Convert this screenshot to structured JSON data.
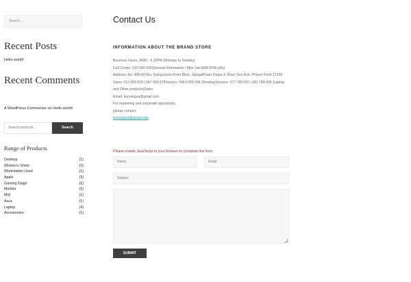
{
  "sidebar": {
    "search_placeholder": "Search ...",
    "recent_posts_title": "Recent Posts",
    "recent_posts_item": "Hello world!",
    "recent_comments_title": "Recent Comments",
    "recent_comments_item": "A WordPress Commenter on Hello world!",
    "product_search_placeholder": "Search products…",
    "product_search_button": "Search",
    "range_title": "Range of Products",
    "range_items": [
      {
        "label": "Desktop",
        "count": "(1)"
      },
      {
        "label": "Women's Shirts",
        "count": "(2)"
      },
      {
        "label": "Workstation Used",
        "count": "(1)"
      },
      {
        "label": "Apple",
        "count": "(3)"
      },
      {
        "label": "Gaming Dsign",
        "count": "(1)"
      },
      {
        "label": "Monitor",
        "count": "(1)"
      },
      {
        "label": "MSI",
        "count": "(1)"
      },
      {
        "label": "Asus",
        "count": "(1)"
      },
      {
        "label": "Laptop",
        "count": "(4)"
      },
      {
        "label": "Accessories",
        "count": "(1)"
      }
    ]
  },
  "main": {
    "title": "Contact Us",
    "info_heading": "INFORMATION ABOUT THE BRAND STORE",
    "info_lines": {
      "hours": "Business Hours: 8AM – 5.30PM (Monday to Sunday)",
      "call_center": "Call Center: 010 909 500(General Information / Mon-Sat 8AM-5PM only)",
      "address": "Address: No. 405-407Eo, Kampuchea Krom Blvd., SangatPsaer Depor 3, Khan Toul Kok, Phnom Penh 12155",
      "sales": "Sales: 012 909 878 | 087 909 878Service: 098 6789 008 (Desktop)Service: 077 789 002 | 081 789 008 (Laptop and Other products)Sales",
      "email": "Email: bunningva@gmail.com",
      "marketing": "For marketing and corporate opportunity,",
      "please_contact": "please contact:",
      "contact_link": "bunningva@gmail.com",
      "dot": "."
    },
    "js_warning": "Please enable JavaScript in your browser to complete this form.",
    "form": {
      "name_placeholder": "Name",
      "email_placeholder": "Email",
      "subject_placeholder": "Subject",
      "submit_label": "SUBMIT"
    }
  },
  "colors": {
    "accent_link": "#1aa39a",
    "warning_text": "#a82a2a",
    "button_bg": "#3f3f3f"
  }
}
